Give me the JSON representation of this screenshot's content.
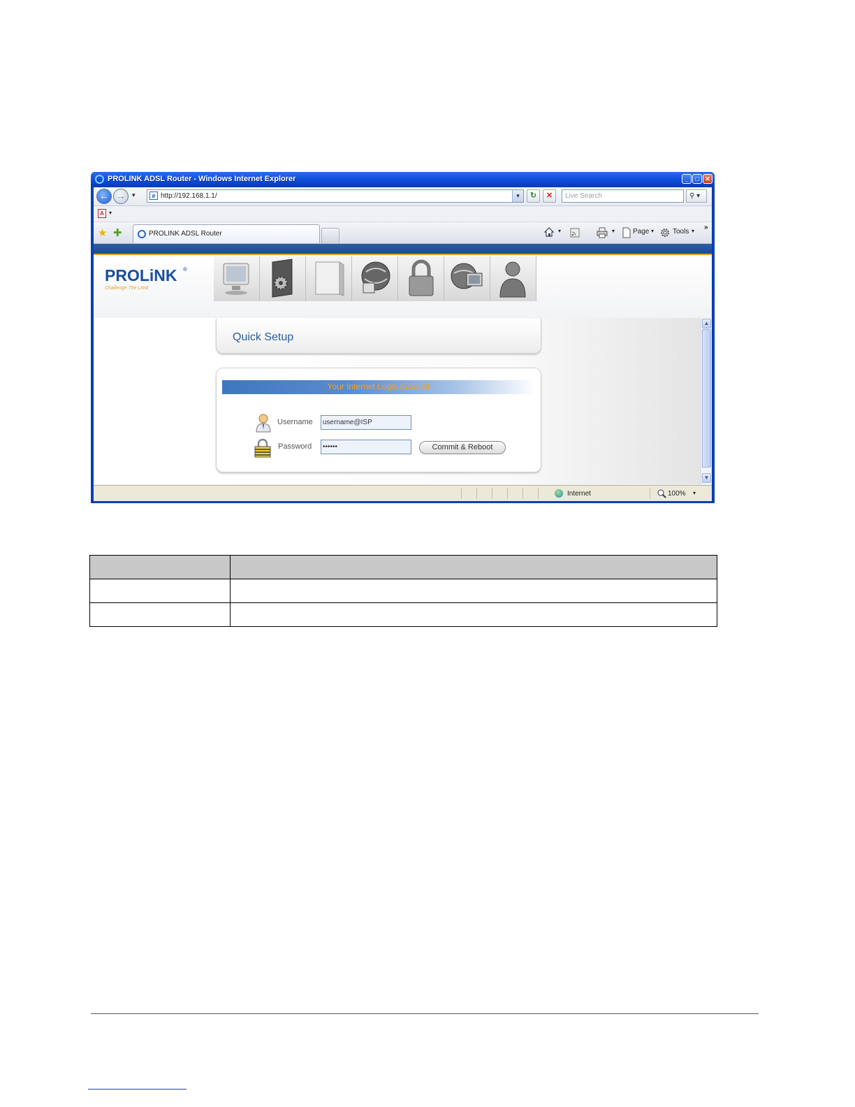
{
  "window": {
    "title": "PROLINK ADSL Router - Windows Internet Explorer",
    "min_glyph": "_",
    "max_glyph": "□",
    "close_glyph": "✕"
  },
  "navbar": {
    "back_glyph": "←",
    "fwd_glyph": "→",
    "dropdown_glyph": "▾",
    "address": "http://192.168.1.1/",
    "search_placeholder": "Live Search",
    "search_glyph": "⚲ ▾"
  },
  "tabs": [
    {
      "label": "PROLINK ADSL Router"
    }
  ],
  "command_bar": {
    "page_label": "Page",
    "tools_label": "Tools",
    "more_glyph": "»"
  },
  "router": {
    "logo": "PROLiNK",
    "logo_reg": "®",
    "slogan": "Challenge The Limit",
    "nav_icons": [
      "monitor-icon",
      "settings-icon",
      "device-icon",
      "network-globe-icon",
      "lock-icon",
      "internet-globe-icon",
      "user-icon"
    ],
    "page_title": "Quick Setup",
    "login_title": "Your Internet Login Account",
    "username_label": "Username",
    "username_value": "username@ISP",
    "password_label": "Password",
    "password_value": "••••••",
    "commit_label": "Commit & Reboot"
  },
  "statusbar": {
    "zone": "Internet",
    "zoom": "100%"
  },
  "colors": {
    "title_bar": "#0b49d6",
    "router_blue": "#1d4b8c",
    "router_orange": "#f0a020",
    "heading_blue": "#2a5d9a"
  }
}
